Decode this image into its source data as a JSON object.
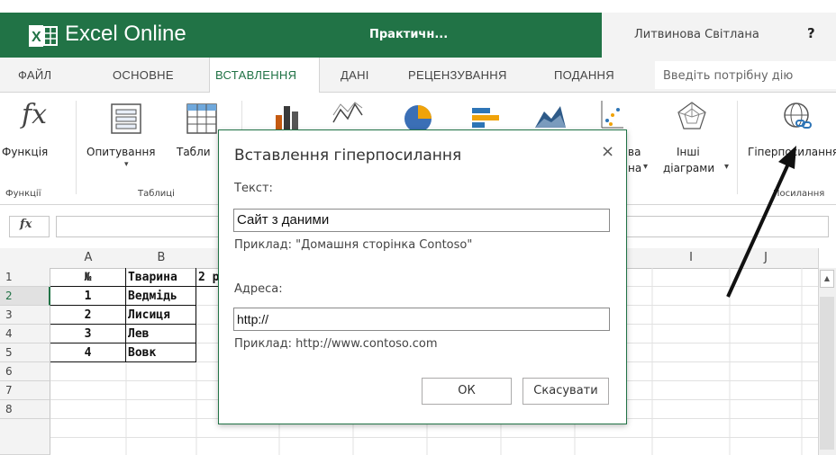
{
  "titlebar": {
    "app_name": "Excel Online",
    "doc_title": "Практичн...",
    "user_name": "Литвинова Світлана",
    "help": "?",
    "colors": {
      "green": "#217346",
      "gray": "#f3f3f3"
    }
  },
  "tabs": [
    {
      "label": "ФАЙЛ"
    },
    {
      "label": "ОСНОВНЕ"
    },
    {
      "label": "ВСТАВЛЕННЯ",
      "active": true
    },
    {
      "label": "ДАНІ"
    },
    {
      "label": "РЕЦЕНЗУВАННЯ"
    },
    {
      "label": "ПОДАННЯ"
    }
  ],
  "tell_me": {
    "placeholder": "Введіть потрібну дію"
  },
  "ribbon": {
    "function_label": "Функція",
    "function_icon_text": "fx",
    "survey_label": "Опитування",
    "table_label": "Табли",
    "other_charts_label_1": "Інші",
    "other_charts_label_2": "діаграми",
    "partial_chart_label_1": "ва",
    "partial_chart_label_2": "на",
    "hyperlink_label": "Гіперпосилання",
    "groups": {
      "functions": "Функції",
      "tables": "Таблиці",
      "links": "Посилання"
    }
  },
  "formula_bar": {
    "fx": "fx",
    "value": ""
  },
  "grid": {
    "columns": [
      "A",
      "B",
      "",
      "",
      "",
      "",
      "",
      "",
      "I",
      "J"
    ],
    "rows": [
      "1",
      "2",
      "3",
      "4",
      "5",
      "6",
      "7",
      "8"
    ],
    "active_row": "2",
    "cells": [
      [
        "№",
        "Тварина",
        "2 р"
      ],
      [
        "1",
        "Ведмідь",
        ""
      ],
      [
        "2",
        "Лисиця",
        ""
      ],
      [
        "3",
        "Лев",
        ""
      ],
      [
        "4",
        "Вовк",
        ""
      ]
    ]
  },
  "dialog": {
    "title": "Вставлення гіперпосилання",
    "close": "×",
    "text_label": "Текст:",
    "text_value": "Сайт з даними",
    "text_example": "Приклад: \"Домашня сторінка Contoso\"",
    "address_label": "Адреса:",
    "address_value": "http://",
    "address_example": "Приклад: http://www.contoso.com",
    "ok": "ОК",
    "cancel": "Скасувати"
  }
}
